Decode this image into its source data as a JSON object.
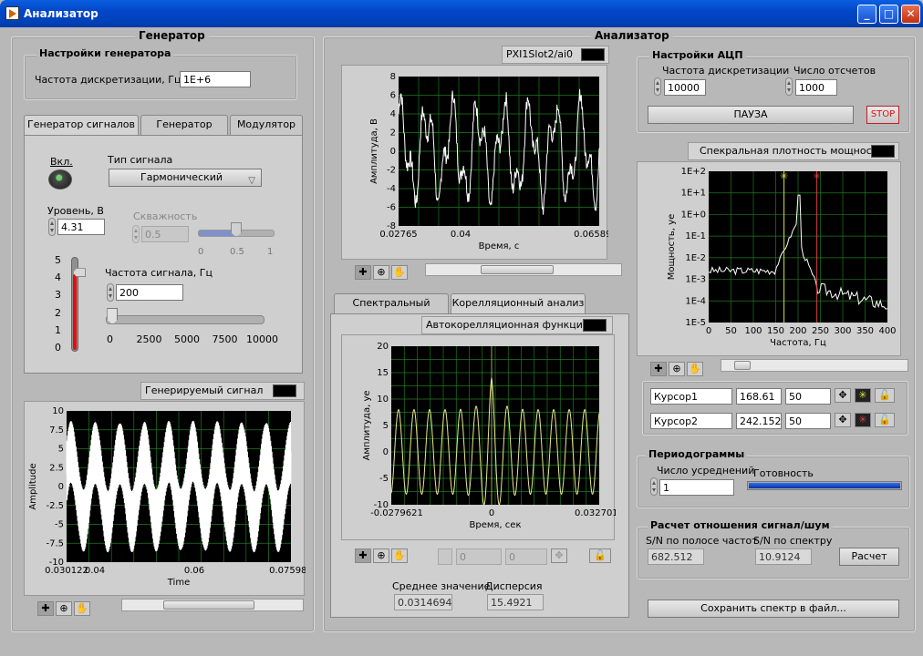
{
  "window": {
    "title": "Анализатор",
    "minimize": "_",
    "maximize": "□",
    "close": "✕"
  },
  "generator": {
    "header": "Генератор",
    "settings_header": "Настройки генератора",
    "sample_rate_label": "Частота дискретизации, Гц",
    "sample_rate_value": "1E+6",
    "tabs": [
      "Генератор сигналов",
      "Генератор шума",
      "Модулятор"
    ],
    "on_label": "Вкл.",
    "signal_type_label": "Тип сигнала",
    "signal_type_value": "Гармонический",
    "level_label": "Уровень, В",
    "level_value": "4.31",
    "duty_label": "Скважность",
    "duty_value": "0.5",
    "duty_slider_fraction": 0.5,
    "duty_ticks": [
      "0",
      "0.5",
      "1"
    ],
    "level_gauge_value": 4.31,
    "level_ticks": [
      "5",
      "4",
      "3",
      "2",
      "1",
      "0"
    ],
    "freq_label": "Частота сигнала, Гц",
    "freq_value": "200",
    "freq_slider_value": 200,
    "freq_ticks": [
      "0",
      "2500",
      "5000",
      "7500",
      "10000"
    ],
    "graph_title": "Генерируемый сигнал",
    "graph_xlabel": "Time",
    "graph_ylabel": "Amplitude",
    "graph_x_ticks": [
      "0.030122",
      "0.04",
      "0.06",
      "0.075981"
    ],
    "graph_y_ticks": [
      "10",
      "7.5",
      "5",
      "2.5",
      "0",
      "-2.5",
      "-5",
      "-7.5",
      "-10"
    ]
  },
  "analyzer": {
    "header": "Анализатор",
    "acq_graph_title": "PXI1Slot2/ai0",
    "acq_ylabel": "Амплитуда, В",
    "acq_xlabel": "Время, с",
    "acq_x_ticks": [
      "0.02765",
      "0.04",
      "0.065899"
    ],
    "acq_y_ticks": [
      "8",
      "6",
      "4",
      "2",
      "0",
      "-2",
      "-4",
      "-6",
      "-8"
    ],
    "tabs": [
      "Спектральный анализ",
      "Корелляционный анализ"
    ],
    "acf_title": "Автокорелляционная функция",
    "acf_ylabel": "Амплитуда, уе",
    "acf_xlabel": "Время, сек",
    "acf_x_ticks": [
      "-0.0279621",
      "0",
      "0.0327014"
    ],
    "acf_y_ticks": [
      "20",
      "15",
      "10",
      "5",
      "0",
      "-5",
      "-10"
    ],
    "acf_cursor_value1": "0",
    "acf_cursor_value2": "0",
    "mean_label": "Среднее значение",
    "mean_value": "0.0314694",
    "variance_label": "Дисперсия",
    "variance_value": "15.4921",
    "adc_header": "Настройки АЦП",
    "adc_rate_label": "Частота дискретизации",
    "adc_rate_value": "10000",
    "adc_count_label": "Число отсчетов",
    "adc_count_value": "1000",
    "pause_label": "ПАУЗА",
    "stop_label": "STOP",
    "psd_title": "Спекральная плотность мощности",
    "psd_ylabel": "Мощность, уе",
    "psd_xlabel": "Частота, Гц",
    "psd_x_ticks": [
      "0",
      "50",
      "100",
      "150",
      "200",
      "250",
      "300",
      "350",
      "400"
    ],
    "psd_y_ticks": [
      "1E+2",
      "1E+1",
      "1E+0",
      "1E-1",
      "1E-2",
      "1E-3",
      "1E-4",
      "1E-5"
    ],
    "cursors": [
      {
        "name": "Курсор1",
        "x": "168.61",
        "y": "50"
      },
      {
        "name": "Курсор2",
        "x": "242.152",
        "y": "50"
      }
    ],
    "periodogram_header": "Периодограммы",
    "averages_label": "Число усреднений",
    "averages_value": "1",
    "ready_label": "Готовность",
    "ready_fraction": 1.0,
    "snr_header": "Расчет отношения сигнал/шум",
    "snr_band_label": "S/N по полосе частот",
    "snr_band_value": "682.512",
    "snr_spec_label": "S/N по спектру",
    "snr_spec_value": "10.9124",
    "calc_label": "Расчет",
    "save_label": "Сохранить спектр в файл..."
  },
  "colors": {
    "plot_bg": "#000000",
    "grid": "#1f7a1f",
    "trace": "#ffffff",
    "acf_trace": "#e8e890",
    "cursor1": "#e0e040",
    "cursor2": "#e04040",
    "gauge": "#e01010",
    "progress": "#1040c0"
  },
  "icons": [
    "crosshair-icon",
    "zoom-icon",
    "hand-icon",
    "move-icon",
    "lock-icon"
  ]
}
